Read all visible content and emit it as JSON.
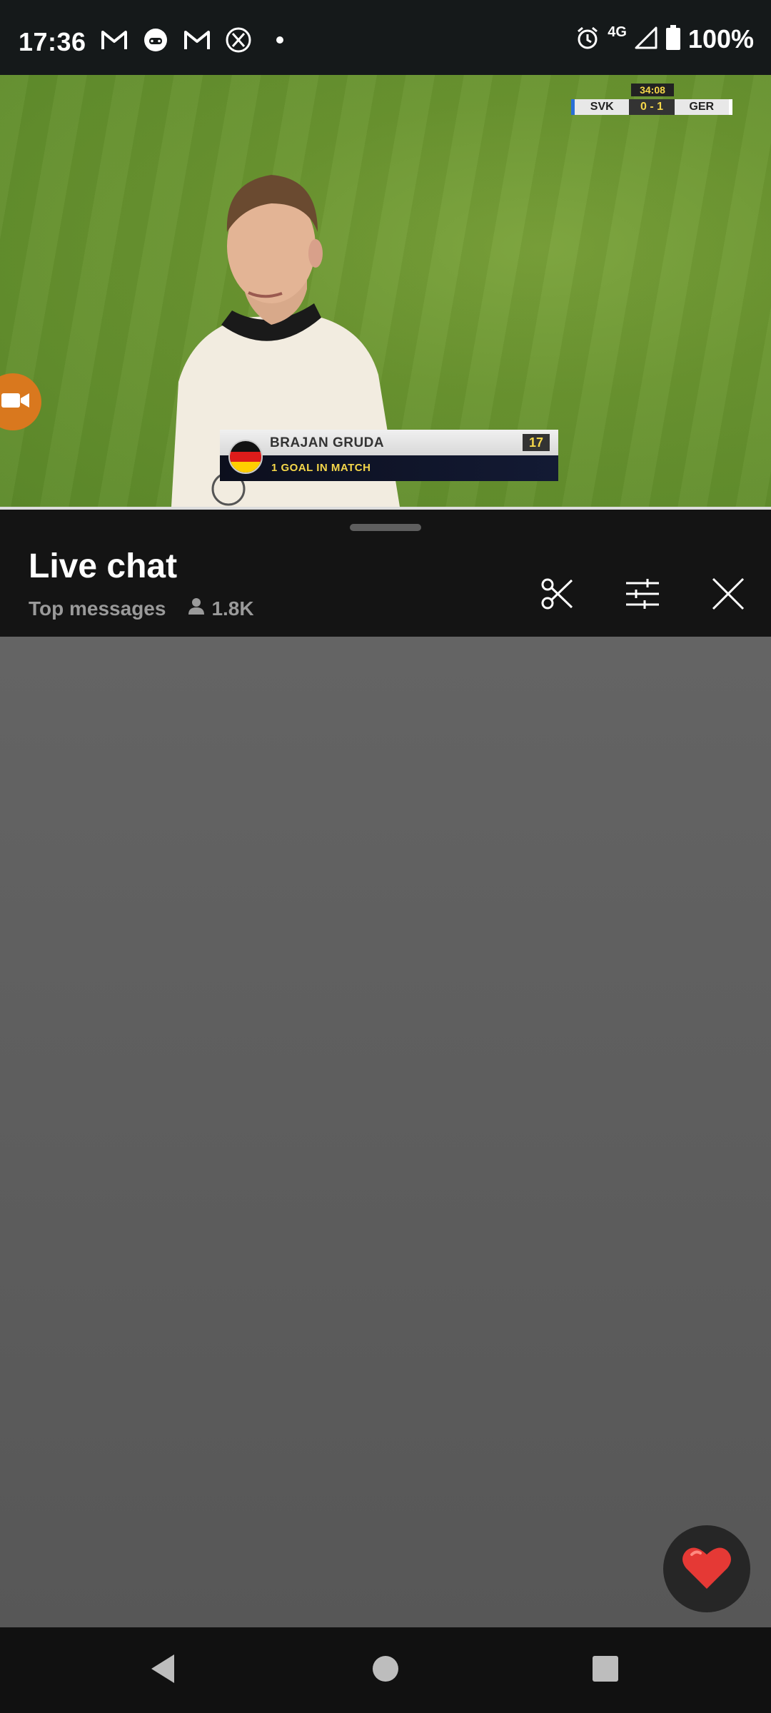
{
  "status_bar": {
    "time": "17:36",
    "network": "4G",
    "battery": "100%",
    "notification_icons": [
      "gmail-icon",
      "game-controller-icon",
      "gmail-icon",
      "x-app-icon",
      "dot-icon"
    ],
    "right_icons": [
      "alarm-icon",
      "signal-icon",
      "battery-icon"
    ]
  },
  "video": {
    "scoreboard": {
      "clock": "34:08",
      "home_team": "SVK",
      "score": "0 - 1",
      "away_team": "GER"
    },
    "lower_third": {
      "player_name": "BRAJAN GRUDA",
      "shirt_number": "17",
      "stat": "1 GOAL IN MATCH",
      "flag_icon": "germany-flag-icon"
    }
  },
  "live_chat": {
    "title": "Live chat",
    "mode": "Top messages",
    "viewer_count": "1.8K",
    "actions": [
      "clip-scissors-icon",
      "filter-sliders-icon",
      "close-icon"
    ]
  },
  "reaction_button": {
    "icon": "heart-icon",
    "color": "#e53935"
  },
  "nav_bar": {
    "buttons": [
      "back-icon",
      "home-icon",
      "recents-icon"
    ]
  }
}
